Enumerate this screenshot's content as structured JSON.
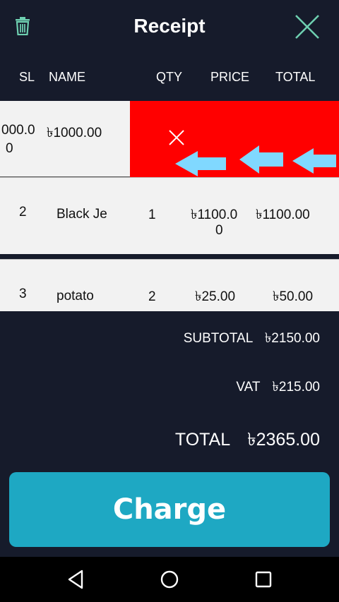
{
  "header": {
    "title": "Receipt",
    "trash_icon": "trash-icon",
    "close_icon": "close-icon",
    "accent": "#6ecfb0"
  },
  "columns": {
    "sl": "SL",
    "name": "NAME",
    "qty": "QTY",
    "price": "PRICE",
    "total": "TOTAL"
  },
  "rows": [
    {
      "price_line1": "000.0",
      "price_line2": "0",
      "total": "৳1000.00",
      "swiped": true,
      "delete_icon": "close-icon",
      "arrow_icon": "arrow-left-icon",
      "delete_color": "#ff0000"
    },
    {
      "sl": "2",
      "name": "Black Je",
      "qty": "1",
      "price_line1": "৳1100.0",
      "price_line2": "0",
      "total": "৳1100.00"
    },
    {
      "sl": "3",
      "name": "potato",
      "qty": "2",
      "price": "৳25.00",
      "total": "৳50.00"
    }
  ],
  "summary": {
    "subtotal_label": "SUBTOTAL",
    "subtotal_value": "৳2150.00",
    "vat_label": "VAT",
    "vat_value": "৳215.00",
    "total_label": "TOTAL",
    "total_value": "৳2365.00"
  },
  "charge_button": {
    "label": "Charge",
    "color": "#1ea8c3"
  },
  "navbar": {
    "back_icon": "back-icon",
    "home_icon": "home-icon",
    "recents_icon": "recents-icon"
  }
}
